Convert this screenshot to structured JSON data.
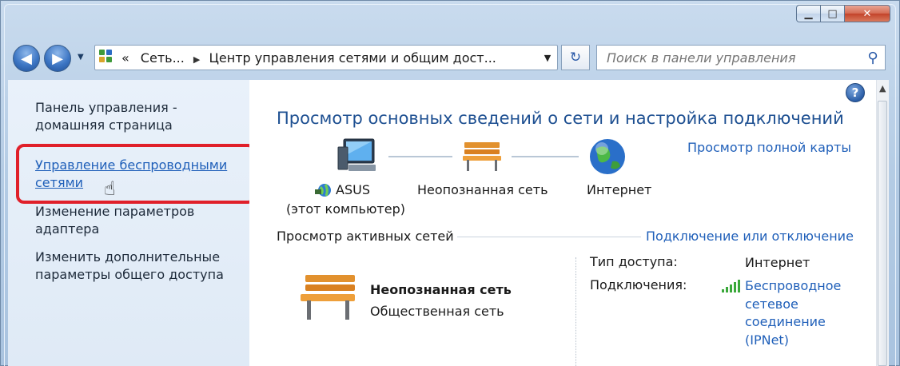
{
  "window": {
    "caption_minimize": "▁",
    "caption_maximize": "□",
    "caption_close": "✕"
  },
  "nav": {
    "back_glyph": "◀",
    "forward_glyph": "▶",
    "dropdown_glyph": "▼"
  },
  "address": {
    "prefix": "«",
    "crumb1": "Сеть...",
    "crumb2": "Центр управления сетями и общим дост...",
    "sep": "▶",
    "drop": "▼",
    "refresh_glyph": "↻"
  },
  "search": {
    "placeholder": "Поиск в панели управления",
    "icon_glyph": "⚲"
  },
  "sidebar": {
    "home": [
      "Панель управления -",
      "домашняя страница"
    ],
    "wireless": [
      "Управление беспроводными",
      "сетями"
    ],
    "adapter": [
      "Изменение параметров",
      "адаптера"
    ],
    "sharing": [
      "Изменить дополнительные",
      "параметры общего доступа"
    ]
  },
  "main": {
    "help_glyph": "?",
    "title": "Просмотр основных сведений о сети и настройка подключений",
    "full_map_link": "Просмотр полной карты",
    "map": {
      "computer_name": "ASUS",
      "computer_sub": "(этот компьютер)",
      "unknown_network": "Неопознанная сеть",
      "internet": "Интернет"
    },
    "active_section": "Просмотр активных сетей",
    "connect_link": "Подключение или отключение",
    "active_network": {
      "name": "Неопознанная сеть",
      "type": "Общественная сеть"
    },
    "props": {
      "access_key": "Тип доступа:",
      "access_val": "Интернет",
      "conn_key": "Подключения:",
      "conn_val": [
        "Беспроводное",
        "сетевое",
        "соединение",
        "(IPNet)"
      ]
    }
  },
  "colors": {
    "link": "#1f5fb9",
    "title": "#1d4f91",
    "highlight": "#e0202a"
  }
}
